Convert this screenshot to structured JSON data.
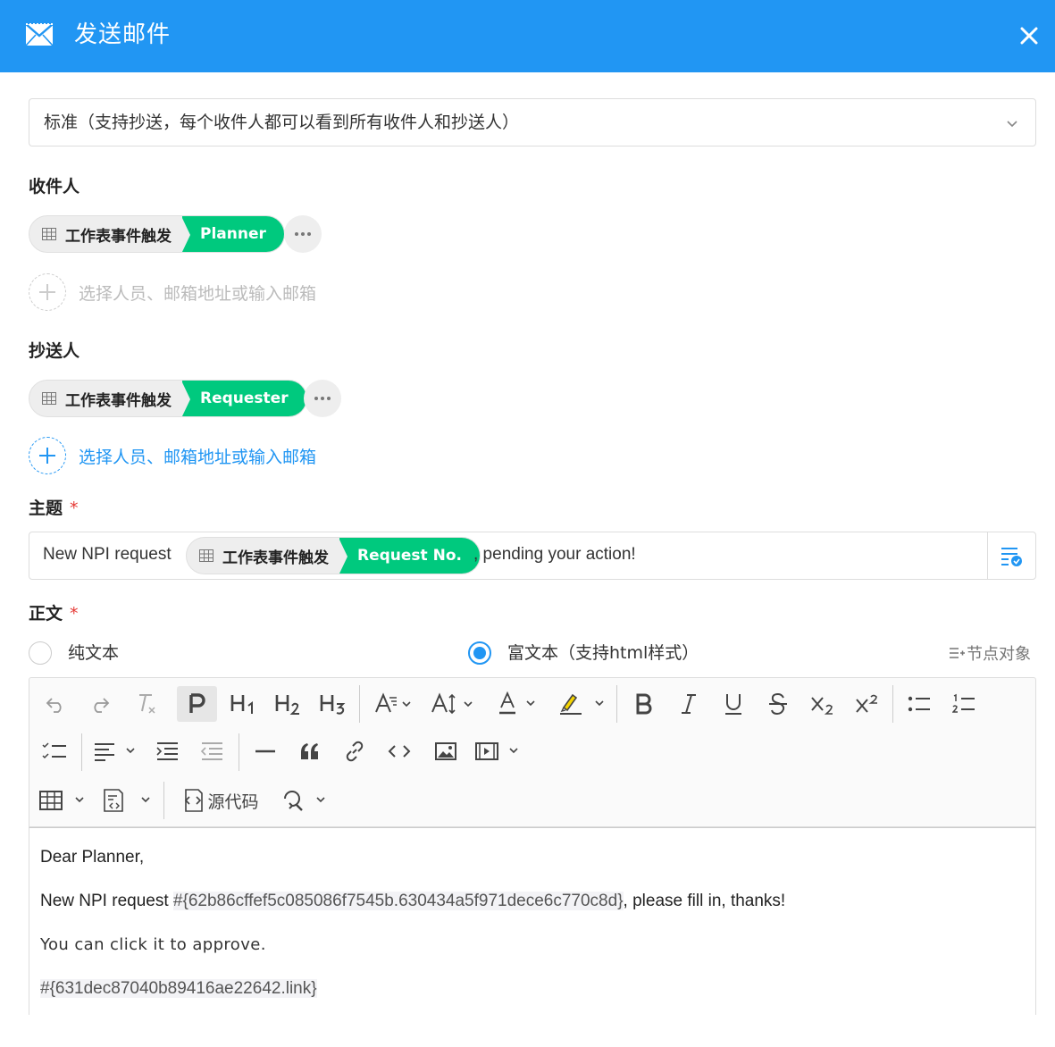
{
  "header": {
    "title": "发送邮件",
    "icon": "mail-icon",
    "color": "#2196f3"
  },
  "send_mode": {
    "selected": "标准（支持抄送，每个收件人都可以看到所有收件人和抄送人）"
  },
  "recipients": {
    "label": "收件人",
    "tag": {
      "source": "工作表事件触发",
      "field": "Planner"
    },
    "add_placeholder": "选择人员、邮箱地址或输入邮箱"
  },
  "cc": {
    "label": "抄送人",
    "tag": {
      "source": "工作表事件触发",
      "field": "Requester"
    },
    "add_placeholder": "选择人员、邮箱地址或输入邮箱"
  },
  "subject": {
    "label": "主题",
    "required_mark": "*",
    "prefix": "New NPI request",
    "tag": {
      "source": "工作表事件触发",
      "field": "Request No."
    },
    "suffix": ", pending your action!"
  },
  "body": {
    "label": "正文",
    "required_mark": "*",
    "format_options": [
      "纯文本",
      "富文本（支持html样式）"
    ],
    "selected_format": "富文本（支持html样式）",
    "node_object_label": "节点对象",
    "toolbar": {
      "source_code_label": "源代码"
    },
    "content": {
      "line1": "Dear Planner,",
      "line2_prefix": "New NPI request ",
      "line2_token": "#{62b86cffef5c085086f7545b.630434a5f971dece6c770c8d}",
      "line2_suffix": ", please fill in, thanks!",
      "line3": "You can click it to approve.",
      "line4_token": "#{631dec87040b89416ae22642.link}"
    }
  },
  "colors": {
    "accent": "#2196f3",
    "tag_green": "#00c97e",
    "required": "#e53935"
  }
}
